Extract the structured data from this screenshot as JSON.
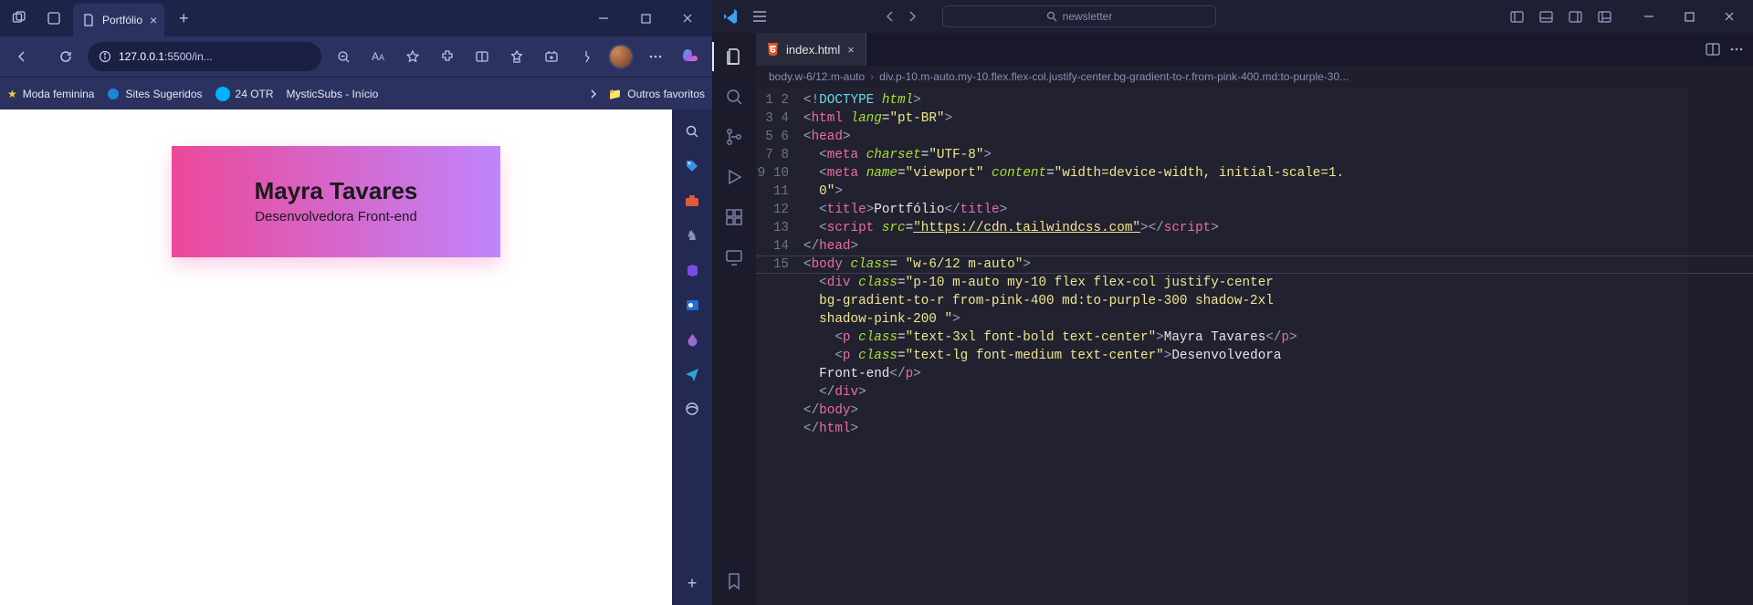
{
  "edge": {
    "tab": {
      "title": "Portfólio"
    },
    "address": {
      "host": "127.0.0.1",
      "rest": ":5500/in..."
    },
    "bookmarks": {
      "moda": "Moda feminina",
      "sites": "Sites Sugeridos",
      "otr": "24 OTR",
      "mystic": "MysticSubs - Início",
      "outros": "Outros favoritos"
    }
  },
  "page_rendered": {
    "title": "Mayra Tavares",
    "subtitle": "Desenvolvedora Front-end"
  },
  "vscode": {
    "search_placeholder": "newsletter",
    "tab": {
      "label": "index.html"
    },
    "breadcrumb": {
      "seg1": "body.w-6/12.m-auto",
      "seg2": "div.p-10.m-auto.my-10.flex.flex-col.justify-center.bg-gradient-to-r.from-pink-400.md:to-purple-30..."
    },
    "code": {
      "l1": {
        "doctype_kw": "DOCTYPE",
        "doctype_arg": "html"
      },
      "l2": {
        "tag": "html",
        "attr": "lang",
        "val": "\"pt-BR\""
      },
      "l3": {
        "tag": "head"
      },
      "l4": {
        "tag": "meta",
        "attr": "charset",
        "val": "\"UTF-8\""
      },
      "l5": {
        "tag": "meta",
        "attr1": "name",
        "val1": "\"viewport\"",
        "attr2": "content",
        "val2_a": "\"width=device-width, initial-scale=1.",
        "val2_b": "0\""
      },
      "l6": {
        "tag": "title",
        "text": "Portfólio"
      },
      "l7": {
        "tag": "script",
        "attr": "src",
        "val": "\"https://cdn.tailwindcss.com\""
      },
      "l8": {
        "tag": "head"
      },
      "l9": {
        "tag": "body",
        "attr": "class",
        "val": " \"w-6/12 m-auto\""
      },
      "l10": {
        "tag": "div",
        "attr": "class",
        "val_a": "\"p-10 m-auto my-10 flex flex-col justify-center ",
        "val_b": "bg-gradient-to-r from-pink-400 md:to-purple-300 shadow-2xl ",
        "val_c": "shadow-pink-200 \""
      },
      "l11": {
        "tag": "p",
        "attr": "class",
        "val": "\"text-3xl font-bold text-center\"",
        "text": "Mayra Tavares"
      },
      "l12": {
        "tag": "p",
        "attr": "class",
        "val": "\"text-lg font-medium text-center\"",
        "text_a": "Desenvolvedora ",
        "text_b": "Front-end"
      },
      "l13": {
        "tag": "div"
      },
      "l14": {
        "tag": "body"
      },
      "l15": {
        "tag": "html"
      }
    },
    "line_count": 15
  }
}
